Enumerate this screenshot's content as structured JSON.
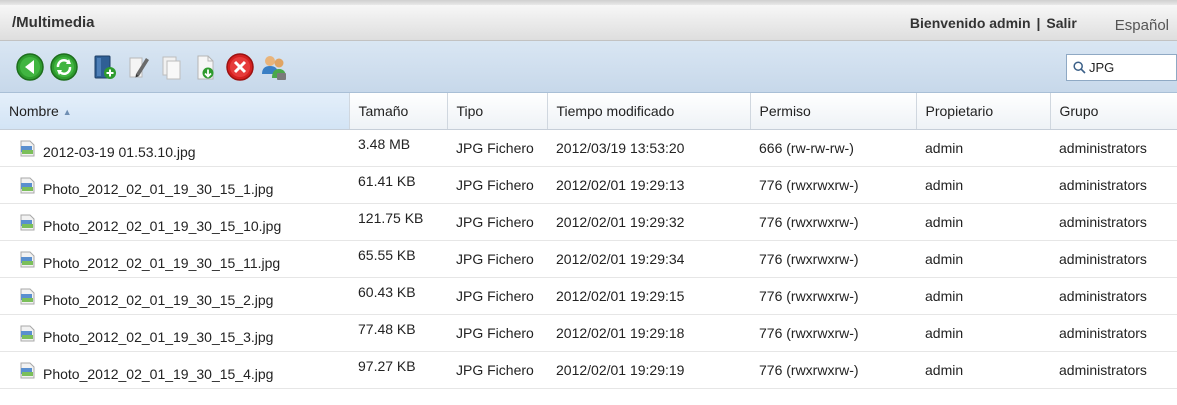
{
  "header": {
    "path": "/Multimedia",
    "welcome": "Bienvenido admin",
    "separator": "|",
    "logout": "Salir",
    "language": "Español"
  },
  "toolbar": {
    "buttons": [
      {
        "icon": "back-icon"
      },
      {
        "icon": "refresh-icon"
      },
      {
        "icon": "new-folder-icon"
      },
      {
        "icon": "rename-icon"
      },
      {
        "icon": "copy-icon"
      },
      {
        "icon": "upload-icon"
      },
      {
        "icon": "delete-icon"
      },
      {
        "icon": "permissions-users-icon"
      }
    ],
    "search": {
      "value": "JPG",
      "placeholder": ""
    }
  },
  "table": {
    "columns": [
      "Nombre",
      "Tamaño",
      "Tipo",
      "Tiempo modificado",
      "Permiso",
      "Propietario",
      "Grupo"
    ],
    "sort_indicator": "▲",
    "rows": [
      {
        "name": "2012-03-19 01.53.10.jpg",
        "size": "3.48 MB",
        "type": "JPG Fichero",
        "modified": "2012/03/19 13:53:20",
        "permission": "666 (rw-rw-rw-)",
        "owner": "admin",
        "group": "administrators"
      },
      {
        "name": "Photo_2012_02_01_19_30_15_1.jpg",
        "size": "61.41 KB",
        "type": "JPG Fichero",
        "modified": "2012/02/01 19:29:13",
        "permission": "776 (rwxrwxrw-)",
        "owner": "admin",
        "group": "administrators"
      },
      {
        "name": "Photo_2012_02_01_19_30_15_10.jpg",
        "size": "121.75 KB",
        "type": "JPG Fichero",
        "modified": "2012/02/01 19:29:32",
        "permission": "776 (rwxrwxrw-)",
        "owner": "admin",
        "group": "administrators"
      },
      {
        "name": "Photo_2012_02_01_19_30_15_11.jpg",
        "size": "65.55 KB",
        "type": "JPG Fichero",
        "modified": "2012/02/01 19:29:34",
        "permission": "776 (rwxrwxrw-)",
        "owner": "admin",
        "group": "administrators"
      },
      {
        "name": "Photo_2012_02_01_19_30_15_2.jpg",
        "size": "60.43 KB",
        "type": "JPG Fichero",
        "modified": "2012/02/01 19:29:15",
        "permission": "776 (rwxrwxrw-)",
        "owner": "admin",
        "group": "administrators"
      },
      {
        "name": "Photo_2012_02_01_19_30_15_3.jpg",
        "size": "77.48 KB",
        "type": "JPG Fichero",
        "modified": "2012/02/01 19:29:18",
        "permission": "776 (rwxrwxrw-)",
        "owner": "admin",
        "group": "administrators"
      },
      {
        "name": "Photo_2012_02_01_19_30_15_4.jpg",
        "size": "97.27 KB",
        "type": "JPG Fichero",
        "modified": "2012/02/01 19:29:19",
        "permission": "776 (rwxrwxrw-)",
        "owner": "admin",
        "group": "administrators"
      }
    ],
    "file_icon": "jpg-file-icon"
  },
  "colors": {
    "toolbar_bg": "#d0dfee",
    "sorted_header_bg": "#dce9f6",
    "green_button": "#2e9b2e",
    "delete_red": "#d42020"
  }
}
